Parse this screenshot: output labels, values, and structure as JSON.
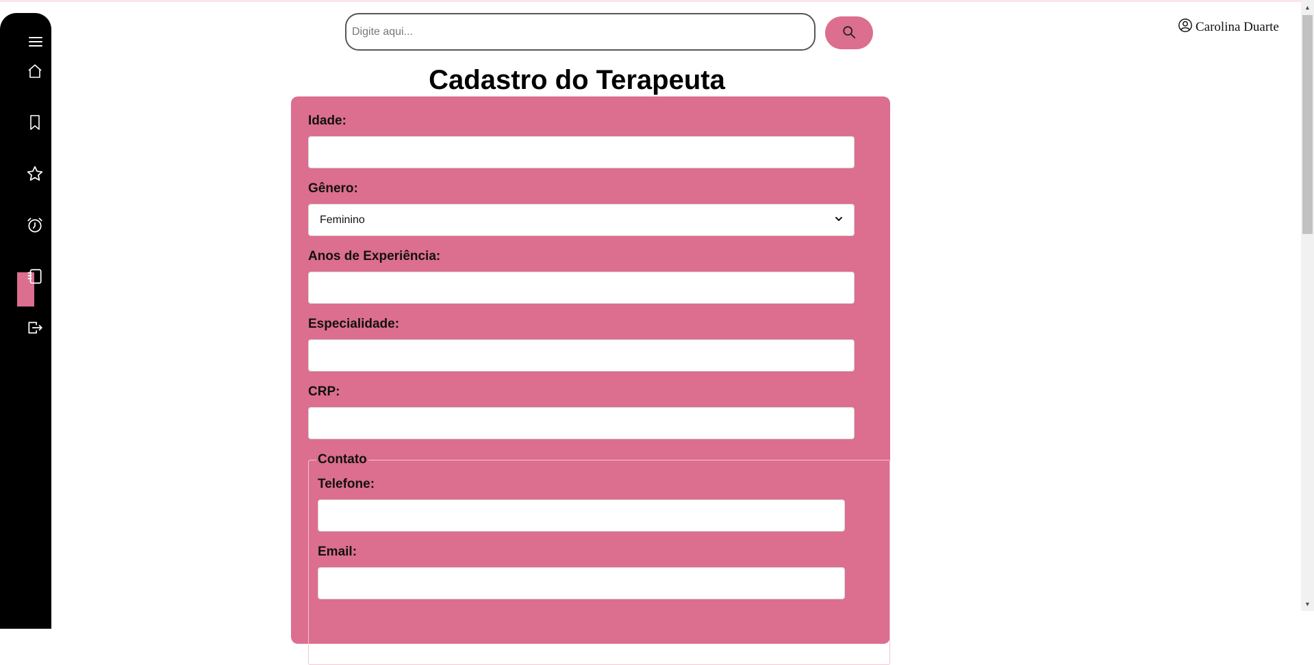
{
  "search": {
    "placeholder": "Digite aqui..."
  },
  "user": {
    "name": "Carolina Duarte"
  },
  "sidebar": {
    "items": [
      {
        "icon": "menu-icon"
      },
      {
        "icon": "home-icon"
      },
      {
        "icon": "bookmark-icon"
      },
      {
        "icon": "star-icon"
      },
      {
        "icon": "alarm-icon"
      },
      {
        "icon": "notebook-icon",
        "active": true
      },
      {
        "icon": "logout-icon"
      }
    ]
  },
  "page": {
    "title": "Cadastro do Terapeuta"
  },
  "form": {
    "idade_label": "Idade:",
    "genero_label": "Gênero:",
    "genero_value": "Feminino",
    "anos_label": "Anos de Experiência:",
    "especialidade_label": "Especialidade:",
    "crp_label": "CRP:",
    "contato_legend": "Contato",
    "telefone_label": "Telefone:",
    "email_label": "Email:"
  },
  "colors": {
    "accent": "#dc6e8f",
    "sidebar": "#000000"
  }
}
